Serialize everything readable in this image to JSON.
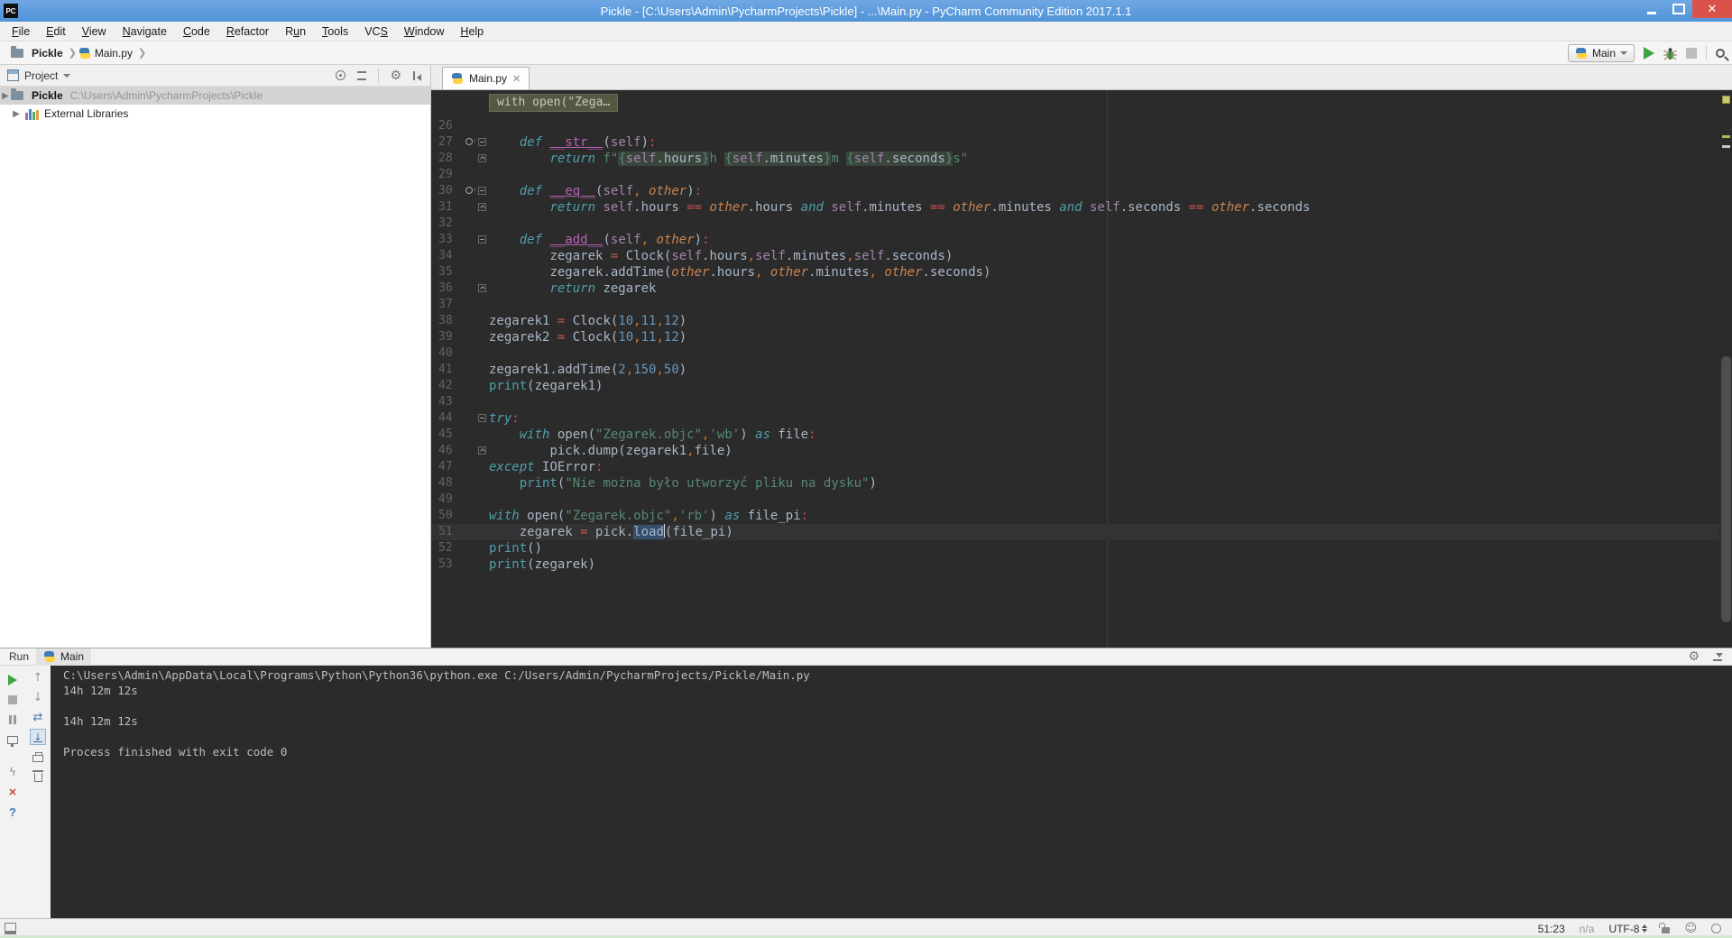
{
  "window": {
    "title": "Pickle - [C:\\Users\\Admin\\PycharmProjects\\Pickle] - ...\\Main.py - PyCharm Community Edition 2017.1.1",
    "app_badge": "PC"
  },
  "menu": {
    "items": [
      {
        "label": "File",
        "mnemonic_index": 0
      },
      {
        "label": "Edit",
        "mnemonic_index": 0
      },
      {
        "label": "View",
        "mnemonic_index": 0
      },
      {
        "label": "Navigate",
        "mnemonic_index": 0
      },
      {
        "label": "Code",
        "mnemonic_index": 0
      },
      {
        "label": "Refactor",
        "mnemonic_index": 0
      },
      {
        "label": "Run",
        "mnemonic_index": 1
      },
      {
        "label": "Tools",
        "mnemonic_index": 0
      },
      {
        "label": "VCS",
        "mnemonic_index": 2
      },
      {
        "label": "Window",
        "mnemonic_index": 0
      },
      {
        "label": "Help",
        "mnemonic_index": 0
      }
    ]
  },
  "navbar": {
    "crumbs": [
      "Pickle",
      "Main.py"
    ],
    "run_config": "Main"
  },
  "project_panel": {
    "header": "Project",
    "rows": [
      {
        "name": "Pickle",
        "path": "C:\\Users\\Admin\\PycharmProjects\\Pickle",
        "type": "folder",
        "selected": true
      },
      {
        "name": "External Libraries",
        "path": "",
        "type": "libs",
        "selected": false
      }
    ]
  },
  "editor": {
    "tab": "Main.py",
    "tooltip": "with open(\"Zega…",
    "caret_line": 51,
    "caret_position": "51:23",
    "lines": [
      {
        "n": 26,
        "segs": []
      },
      {
        "n": 27,
        "fold": "start",
        "ovr": true,
        "segs": [
          {
            "t": "    ",
            "c": "txt"
          },
          {
            "t": "def ",
            "c": "kw"
          },
          {
            "t": "__str__",
            "c": "mm"
          },
          {
            "t": "(",
            "c": "txt"
          },
          {
            "t": "self",
            "c": "slf"
          },
          {
            "t": ")",
            "c": "txt"
          },
          {
            "t": ":",
            "c": "red"
          }
        ]
      },
      {
        "n": 28,
        "fold": "end",
        "segs": [
          {
            "t": "        ",
            "c": "txt"
          },
          {
            "t": "return ",
            "c": "kw"
          },
          {
            "t": "f\"",
            "c": "str"
          },
          {
            "t": "{",
            "c": "str",
            "bg": true
          },
          {
            "t": "self",
            "c": "slf",
            "bg": true
          },
          {
            "t": ".hours",
            "c": "txt",
            "bg": true
          },
          {
            "t": "}",
            "c": "str",
            "bg": true
          },
          {
            "t": "h ",
            "c": "str"
          },
          {
            "t": "{",
            "c": "str",
            "bg": true
          },
          {
            "t": "self",
            "c": "slf",
            "bg": true
          },
          {
            "t": ".minutes",
            "c": "txt",
            "bg": true
          },
          {
            "t": "}",
            "c": "str",
            "bg": true
          },
          {
            "t": "m ",
            "c": "str"
          },
          {
            "t": "{",
            "c": "str",
            "bg": true
          },
          {
            "t": "self",
            "c": "slf",
            "bg": true
          },
          {
            "t": ".seconds",
            "c": "txt",
            "bg": true
          },
          {
            "t": "}",
            "c": "str",
            "bg": true
          },
          {
            "t": "s\"",
            "c": "str"
          }
        ]
      },
      {
        "n": 29,
        "segs": []
      },
      {
        "n": 30,
        "fold": "start",
        "ovr": true,
        "segs": [
          {
            "t": "    ",
            "c": "txt"
          },
          {
            "t": "def ",
            "c": "kw"
          },
          {
            "t": "__eq__",
            "c": "mm"
          },
          {
            "t": "(",
            "c": "txt"
          },
          {
            "t": "self",
            "c": "slf"
          },
          {
            "t": ",",
            "c": "op"
          },
          {
            "t": " other",
            "c": "par"
          },
          {
            "t": ")",
            "c": "txt"
          },
          {
            "t": ":",
            "c": "red"
          }
        ]
      },
      {
        "n": 31,
        "fold": "end",
        "segs": [
          {
            "t": "        ",
            "c": "txt"
          },
          {
            "t": "return ",
            "c": "kw"
          },
          {
            "t": "self",
            "c": "slf"
          },
          {
            "t": ".hours ",
            "c": "txt"
          },
          {
            "t": "== ",
            "c": "red"
          },
          {
            "t": "other",
            "c": "par"
          },
          {
            "t": ".hours ",
            "c": "txt"
          },
          {
            "t": "and ",
            "c": "kw"
          },
          {
            "t": "self",
            "c": "slf"
          },
          {
            "t": ".minutes ",
            "c": "txt"
          },
          {
            "t": "== ",
            "c": "red"
          },
          {
            "t": "other",
            "c": "par"
          },
          {
            "t": ".minutes ",
            "c": "txt"
          },
          {
            "t": "and ",
            "c": "kw"
          },
          {
            "t": "self",
            "c": "slf"
          },
          {
            "t": ".seconds ",
            "c": "txt"
          },
          {
            "t": "== ",
            "c": "red"
          },
          {
            "t": "other",
            "c": "par"
          },
          {
            "t": ".seconds",
            "c": "txt"
          }
        ]
      },
      {
        "n": 32,
        "segs": []
      },
      {
        "n": 33,
        "fold": "start",
        "segs": [
          {
            "t": "    ",
            "c": "txt"
          },
          {
            "t": "def ",
            "c": "kw"
          },
          {
            "t": "__add__",
            "c": "mm"
          },
          {
            "t": "(",
            "c": "txt"
          },
          {
            "t": "self",
            "c": "slf"
          },
          {
            "t": ",",
            "c": "op"
          },
          {
            "t": " other",
            "c": "par"
          },
          {
            "t": ")",
            "c": "txt"
          },
          {
            "t": ":",
            "c": "red"
          }
        ]
      },
      {
        "n": 34,
        "segs": [
          {
            "t": "        ",
            "c": "txt"
          },
          {
            "t": "zegarek ",
            "c": "txt"
          },
          {
            "t": "=",
            "c": "red"
          },
          {
            "t": " Clock(",
            "c": "txt"
          },
          {
            "t": "self",
            "c": "slf"
          },
          {
            "t": ".hours",
            "c": "txt"
          },
          {
            "t": ",",
            "c": "op"
          },
          {
            "t": "self",
            "c": "slf"
          },
          {
            "t": ".minutes",
            "c": "txt"
          },
          {
            "t": ",",
            "c": "op"
          },
          {
            "t": "self",
            "c": "slf"
          },
          {
            "t": ".seconds",
            "c": "txt"
          },
          {
            "t": ")",
            "c": "txt"
          }
        ]
      },
      {
        "n": 35,
        "segs": [
          {
            "t": "        ",
            "c": "txt"
          },
          {
            "t": "zegarek.addTime(",
            "c": "txt"
          },
          {
            "t": "other",
            "c": "par"
          },
          {
            "t": ".hours",
            "c": "txt"
          },
          {
            "t": ",",
            "c": "op"
          },
          {
            "t": " ",
            "c": "txt"
          },
          {
            "t": "other",
            "c": "par"
          },
          {
            "t": ".minutes",
            "c": "txt"
          },
          {
            "t": ",",
            "c": "op"
          },
          {
            "t": " ",
            "c": "txt"
          },
          {
            "t": "other",
            "c": "par"
          },
          {
            "t": ".seconds",
            "c": "txt"
          },
          {
            "t": ")",
            "c": "txt"
          }
        ]
      },
      {
        "n": 36,
        "fold": "end",
        "segs": [
          {
            "t": "        ",
            "c": "txt"
          },
          {
            "t": "return ",
            "c": "kw"
          },
          {
            "t": "zegarek",
            "c": "txt"
          }
        ]
      },
      {
        "n": 37,
        "segs": []
      },
      {
        "n": 38,
        "segs": [
          {
            "t": "zegarek1 ",
            "c": "txt"
          },
          {
            "t": "=",
            "c": "red"
          },
          {
            "t": " Clock(",
            "c": "txt"
          },
          {
            "t": "10",
            "c": "num"
          },
          {
            "t": ",",
            "c": "op"
          },
          {
            "t": "11",
            "c": "num"
          },
          {
            "t": ",",
            "c": "op"
          },
          {
            "t": "12",
            "c": "num"
          },
          {
            "t": ")",
            "c": "txt"
          }
        ]
      },
      {
        "n": 39,
        "segs": [
          {
            "t": "zegarek2 ",
            "c": "txt"
          },
          {
            "t": "=",
            "c": "red"
          },
          {
            "t": " Clock(",
            "c": "txt"
          },
          {
            "t": "10",
            "c": "num"
          },
          {
            "t": ",",
            "c": "op"
          },
          {
            "t": "11",
            "c": "num"
          },
          {
            "t": ",",
            "c": "op"
          },
          {
            "t": "12",
            "c": "num"
          },
          {
            "t": ")",
            "c": "txt"
          }
        ]
      },
      {
        "n": 40,
        "segs": []
      },
      {
        "n": 41,
        "segs": [
          {
            "t": "zegarek1.addTime(",
            "c": "txt"
          },
          {
            "t": "2",
            "c": "num"
          },
          {
            "t": ",",
            "c": "op"
          },
          {
            "t": "150",
            "c": "num"
          },
          {
            "t": ",",
            "c": "op"
          },
          {
            "t": "50",
            "c": "num"
          },
          {
            "t": ")",
            "c": "txt"
          }
        ]
      },
      {
        "n": 42,
        "segs": [
          {
            "t": "print",
            "c": "bi"
          },
          {
            "t": "(zegarek1)",
            "c": "txt"
          }
        ]
      },
      {
        "n": 43,
        "segs": []
      },
      {
        "n": 44,
        "fold": "start",
        "segs": [
          {
            "t": "try",
            "c": "kw"
          },
          {
            "t": ":",
            "c": "red"
          }
        ]
      },
      {
        "n": 45,
        "segs": [
          {
            "t": "    ",
            "c": "txt"
          },
          {
            "t": "with ",
            "c": "kw"
          },
          {
            "t": "open(",
            "c": "txt"
          },
          {
            "t": "\"Zegarek.objc\"",
            "c": "str"
          },
          {
            "t": ",",
            "c": "op"
          },
          {
            "t": "'wb'",
            "c": "str"
          },
          {
            "t": ") ",
            "c": "txt"
          },
          {
            "t": "as ",
            "c": "kw"
          },
          {
            "t": "file",
            "c": "txt"
          },
          {
            "t": ":",
            "c": "red"
          }
        ]
      },
      {
        "n": 46,
        "fold": "end",
        "segs": [
          {
            "t": "        ",
            "c": "txt"
          },
          {
            "t": "pick.dump(zegarek1",
            "c": "txt"
          },
          {
            "t": ",",
            "c": "op"
          },
          {
            "t": "file)",
            "c": "txt"
          }
        ]
      },
      {
        "n": 47,
        "segs": [
          {
            "t": "except ",
            "c": "kw"
          },
          {
            "t": "IOError",
            "c": "txt"
          },
          {
            "t": ":",
            "c": "red"
          }
        ]
      },
      {
        "n": 48,
        "segs": [
          {
            "t": "    ",
            "c": "txt"
          },
          {
            "t": "print",
            "c": "bi"
          },
          {
            "t": "(",
            "c": "txt"
          },
          {
            "t": "\"Nie można było utworzyć pliku na dysku\"",
            "c": "str"
          },
          {
            "t": ")",
            "c": "txt"
          }
        ]
      },
      {
        "n": 49,
        "segs": []
      },
      {
        "n": 50,
        "segs": [
          {
            "t": "with ",
            "c": "kw"
          },
          {
            "t": "open(",
            "c": "txt"
          },
          {
            "t": "\"Zegarek.objc\"",
            "c": "str"
          },
          {
            "t": ",",
            "c": "op"
          },
          {
            "t": "'rb'",
            "c": "str"
          },
          {
            "t": ") ",
            "c": "txt"
          },
          {
            "t": "as ",
            "c": "kw"
          },
          {
            "t": "file_pi",
            "c": "txt"
          },
          {
            "t": ":",
            "c": "red"
          }
        ]
      },
      {
        "n": 51,
        "segs": [
          {
            "t": "    ",
            "c": "txt"
          },
          {
            "t": "zegarek ",
            "c": "txt"
          },
          {
            "t": "=",
            "c": "red"
          },
          {
            "t": " pick.",
            "c": "txt"
          },
          {
            "t": "load",
            "c": "txt",
            "hl": true,
            "caret": true
          },
          {
            "t": "(file_pi)",
            "c": "txt"
          }
        ]
      },
      {
        "n": 52,
        "segs": [
          {
            "t": "print",
            "c": "bi"
          },
          {
            "t": "()",
            "c": "txt"
          }
        ]
      },
      {
        "n": 53,
        "segs": [
          {
            "t": "print",
            "c": "bi"
          },
          {
            "t": "(zegarek)",
            "c": "txt"
          }
        ]
      }
    ]
  },
  "run_panel": {
    "label": "Run",
    "tab": "Main",
    "console": [
      "C:\\Users\\Admin\\AppData\\Local\\Programs\\Python\\Python36\\python.exe C:/Users/Admin/PycharmProjects/Pickle/Main.py",
      "14h 12m 12s",
      "",
      "14h 12m 12s",
      "",
      "Process finished with exit code 0"
    ]
  },
  "status_bar": {
    "position": "51:23",
    "scope": "n/a",
    "encoding": "UTF-8"
  },
  "colors": {
    "close": "#d9534a",
    "editor_bg": "#2b2b2b",
    "gutter_text": "#606366",
    "caret_row": "#333333",
    "kw": "#4f9fab",
    "builtin": "#4f9fab",
    "magic": "#b760b1",
    "selfc": "#a284ab",
    "param": "#ca8350",
    "operator": "#cb7832",
    "assign": "#c75450",
    "number": "#6897bb",
    "string": "#578874",
    "text": "#a9b7c6",
    "frag_bg": "#3a463c",
    "ident_hl": "#34506e",
    "run_green": "#3fa33f",
    "error_red": "#c75450",
    "help_blue": "#4a7ab5"
  }
}
